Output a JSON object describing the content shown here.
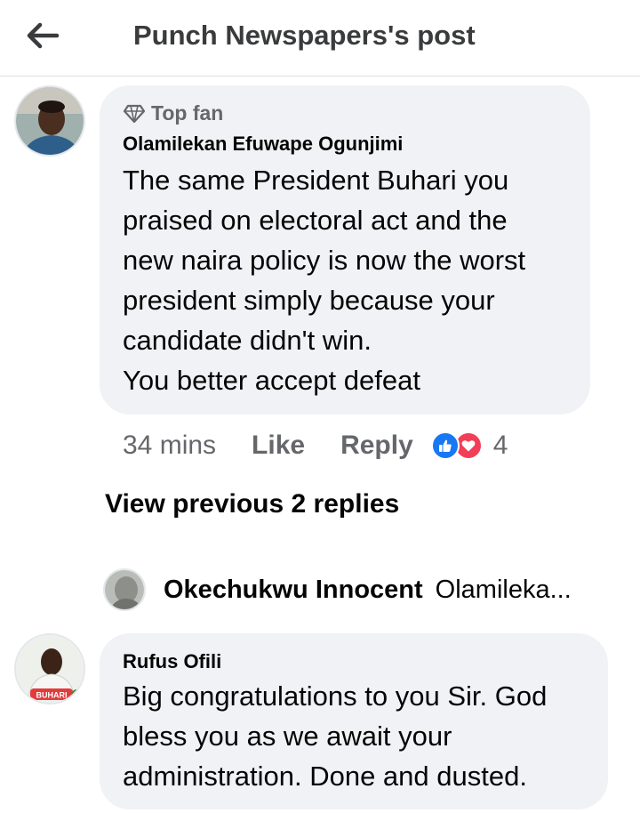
{
  "header": {
    "back_icon": "arrow-left-icon",
    "title": "Punch Newspapers's post"
  },
  "comment": {
    "badge_icon": "diamond-icon",
    "badge": "Top fan",
    "author": "Olamilekan Efuwape Ogunjimi",
    "lines": [
      "The same President Buhari you",
      "praised on electoral act and the",
      "new naira policy is now the worst",
      "president simply because your",
      "candidate didn't win.",
      "You better accept defeat"
    ],
    "time": "34 mins",
    "like_label": "Like",
    "reply_label": "Reply",
    "reaction_icons": [
      "like-icon",
      "love-icon"
    ],
    "reaction_count": "4"
  },
  "replies": {
    "view_previous": "View previous 2 replies",
    "latest": {
      "author": "Okechukwu Innocent",
      "snippet": "Olamileka..."
    }
  },
  "comment2": {
    "author": "Rufus Ofili",
    "avatar_text": "BUHARI",
    "lines": [
      "Big congratulations to you Sir. God",
      "bless you as we await your",
      "administration. Done and dusted."
    ]
  },
  "colors": {
    "bubble": "#f0f2f5",
    "secondary_text": "#65676b",
    "like_blue": "#1877f2",
    "love_red": "#f33e58"
  }
}
